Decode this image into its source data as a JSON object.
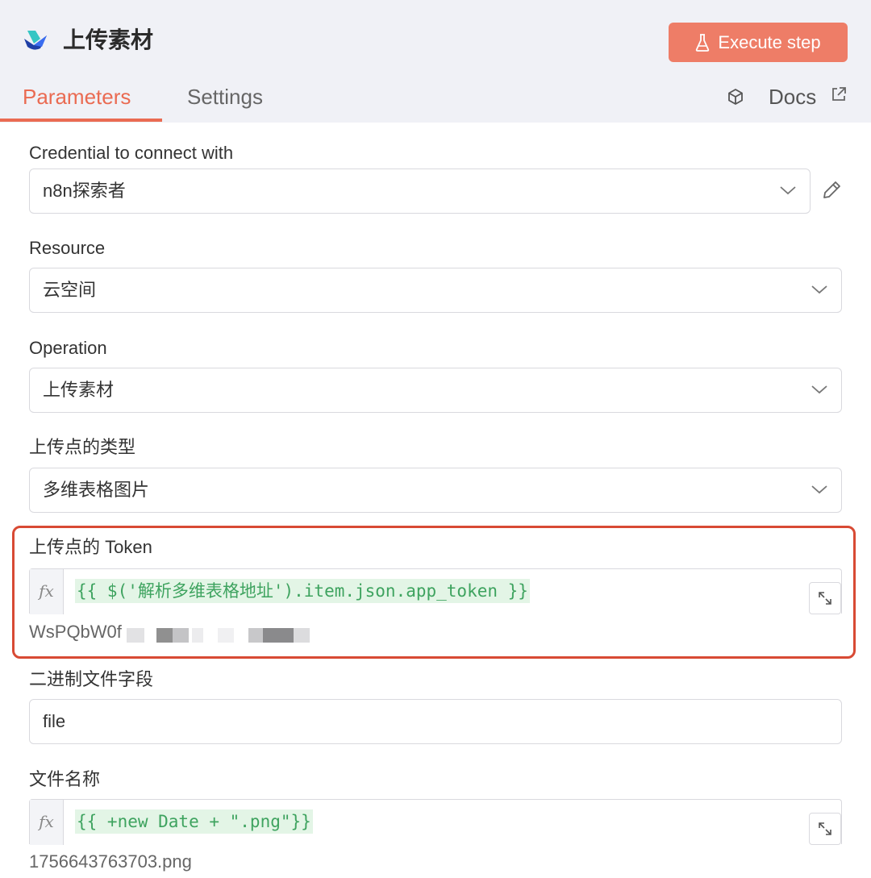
{
  "header": {
    "title": "上传素材",
    "execute_label": "Execute step"
  },
  "tabs": {
    "parameters": "Parameters",
    "settings": "Settings",
    "docs": "Docs"
  },
  "fields": {
    "credential": {
      "label": "Credential to connect with",
      "value": "n8n探索者"
    },
    "resource": {
      "label": "Resource",
      "value": "云空间"
    },
    "operation": {
      "label": "Operation",
      "value": "上传素材"
    },
    "upload_type": {
      "label": "上传点的类型",
      "value": "多维表格图片"
    },
    "token": {
      "label": "上传点的 Token",
      "expression": "{{ $('解析多维表格地址').item.json.app_token }}",
      "result": "WsPQbW0f"
    },
    "binary_field": {
      "label": "二进制文件字段",
      "value": "file"
    },
    "file_name": {
      "label": "文件名称",
      "expression": "{{ +new Date + \".png\"}}",
      "result": "1756643763703.png"
    }
  },
  "fx_label": "fx",
  "colors": {
    "accent": "#ea6b52",
    "execute_bg": "#ee7d67",
    "highlight": "#d84a34",
    "code": "#3ea35f"
  }
}
